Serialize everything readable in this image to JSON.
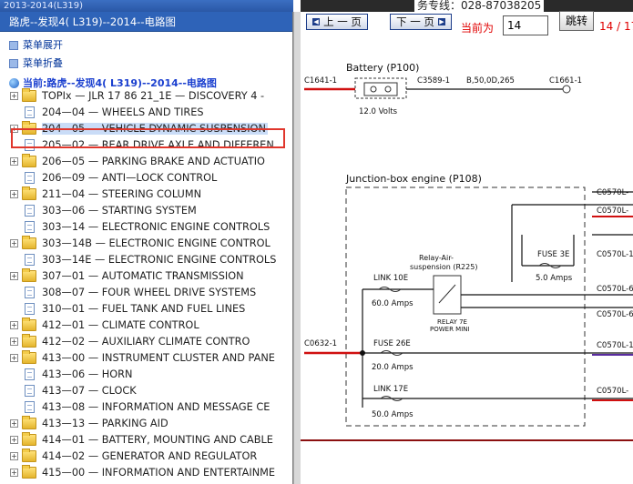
{
  "window": {
    "title_fragment": "2013-2014(L319)"
  },
  "tree": {
    "header": "路虎--发现4( L319)--2014--电路图",
    "ops": {
      "expand_all": "菜单展开",
      "collapse_all": "菜单折叠"
    },
    "current": "当前:路虎--发现4( L319)--2014--电路图",
    "items": [
      {
        "label": "TOPIx — JLR 17 86 21_1E — DISCOVERY 4 -",
        "type": "folder",
        "expandable": true
      },
      {
        "label": "204—04 — WHEELS AND TIRES",
        "type": "doc",
        "expandable": false
      },
      {
        "label": "204—05 — VEHICLE DYNAMIC SUSPENSION",
        "type": "folder",
        "expandable": true,
        "selected": true
      },
      {
        "label": "205—02 — REAR DRIVE AXLE AND DIFFEREN",
        "type": "doc",
        "expandable": false
      },
      {
        "label": "206—05 — PARKING BRAKE AND ACTUATIO",
        "type": "folder",
        "expandable": true
      },
      {
        "label": "206—09 — ANTI—LOCK CONTROL",
        "type": "doc",
        "expandable": false
      },
      {
        "label": "211—04 — STEERING COLUMN",
        "type": "folder",
        "expandable": true
      },
      {
        "label": "303—06 — STARTING SYSTEM",
        "type": "doc",
        "expandable": false
      },
      {
        "label": "303—14 — ELECTRONIC ENGINE CONTROLS",
        "type": "doc",
        "expandable": false
      },
      {
        "label": "303—14B — ELECTRONIC ENGINE CONTROL",
        "type": "folder",
        "expandable": true
      },
      {
        "label": "303—14E — ELECTRONIC ENGINE CONTROLS",
        "type": "doc",
        "expandable": false
      },
      {
        "label": "307—01 — AUTOMATIC TRANSMISSION",
        "type": "folder",
        "expandable": true
      },
      {
        "label": "308—07 — FOUR WHEEL DRIVE SYSTEMS",
        "type": "doc",
        "expandable": false
      },
      {
        "label": "310—01 — FUEL TANK AND FUEL LINES",
        "type": "doc",
        "expandable": false
      },
      {
        "label": "412—01 — CLIMATE CONTROL",
        "type": "folder",
        "expandable": true
      },
      {
        "label": "412—02 — AUXILIARY CLIMATE CONTRO",
        "type": "folder",
        "expandable": true
      },
      {
        "label": "413—00 — INSTRUMENT CLUSTER AND PANE",
        "type": "folder",
        "expandable": true
      },
      {
        "label": "413—06 — HORN",
        "type": "doc",
        "expandable": false
      },
      {
        "label": "413—07 — CLOCK",
        "type": "doc",
        "expandable": false
      },
      {
        "label": "413—08 — INFORMATION AND MESSAGE CE",
        "type": "doc",
        "expandable": false
      },
      {
        "label": "413—13 — PARKING AID",
        "type": "folder",
        "expandable": true
      },
      {
        "label": "414—01 — BATTERY, MOUNTING AND CABLE",
        "type": "folder",
        "expandable": true
      },
      {
        "label": "414—02 — GENERATOR AND REGULATOR",
        "type": "folder",
        "expandable": true
      },
      {
        "label": "415—00 — INFORMATION AND ENTERTAINME",
        "type": "folder",
        "expandable": true
      }
    ]
  },
  "viewer": {
    "hotline": "务专线：028-87038205",
    "prev_label": "上 一 页",
    "next_label": "下 一 页",
    "current_label": "当前为",
    "page_value": "14",
    "jump_label": "跳转",
    "page_count": "14 / 17"
  },
  "diagram": {
    "battery_title": "Battery (P100)",
    "conn_c1641": "C1641-1",
    "conn_c3589": "C3589-1",
    "wire_spec": "B,50,0D,265",
    "conn_c1661": "C1661-1",
    "battery_volts": "12.0 Volts",
    "junction_title": "Junction-box engine (P108)",
    "relay_label_1": "Relay-Air-",
    "relay_label_2": "suspension (R225)",
    "fuse3e_label": "FUSE 3E",
    "fuse3e_amps": "5.0 Amps",
    "link10e_label": "LINK 10E",
    "link10e_amps": "60.0 Amps",
    "relay7e_1": "RELAY 7E",
    "relay7e_2": "POWER MINI",
    "conn_c0632": "C0632-1",
    "fuse26e_label": "FUSE 26E",
    "fuse26e_amps": "20.0 Amps",
    "link17e_label": "LINK 17E",
    "link17e_amps": "50.0 Amps",
    "conn_c0570_a": "C0570L-",
    "conn_c0570_b": "C0570L-",
    "conn_c0570_c": "C0570L-1",
    "conn_c0570_d": "C0570L-6",
    "conn_c0570_e": "C0570L-6",
    "conn_c0570_f": "C0570L-1",
    "conn_c0570_g": "C0570L-"
  },
  "colors": {
    "accent": "#2e63b8",
    "selection_box": "#e0362c",
    "wire_red": "#d01010",
    "page_red": "#e00000"
  }
}
